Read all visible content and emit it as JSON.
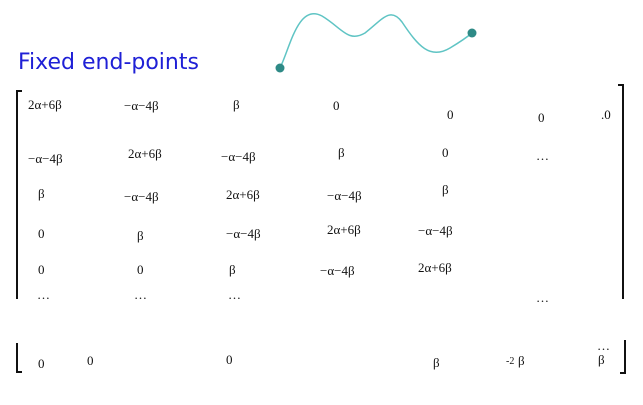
{
  "title": "Fixed end-points",
  "rows": [
    [
      "2α+6β",
      "−α−4β",
      "β",
      "0",
      "0",
      "0",
      ".0"
    ],
    [
      "−α−4β",
      "2α+6β",
      "−α−4β",
      "β",
      "0",
      "…",
      ""
    ],
    [
      "β",
      "−α−4β",
      "2α+6β",
      "−α−4β",
      "β",
      "",
      ""
    ],
    [
      "0",
      "β",
      "−α−4β",
      "2α+6β",
      "−α−4β",
      "",
      ""
    ],
    [
      "0",
      "0",
      "β",
      "−α−4β",
      "2α+6β",
      "",
      ""
    ],
    [
      "…",
      "…",
      "…",
      "",
      "",
      "…",
      ""
    ]
  ],
  "last_row": [
    "0",
    "0",
    "0",
    "β",
    "-2",
    "β",
    "…",
    "β"
  ],
  "colors": {
    "title": "#1f20d6",
    "curve": "#5fc4c4",
    "endpoint": "#2e8a86"
  }
}
